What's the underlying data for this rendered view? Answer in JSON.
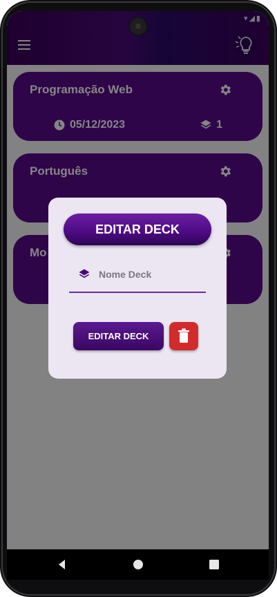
{
  "decks": [
    {
      "title": "Programação Web",
      "date": "05/12/2023",
      "count": "1"
    },
    {
      "title": "Português"
    },
    {
      "title": "Mo"
    }
  ],
  "dialog": {
    "title": "EDITAR DECK",
    "name_placeholder": "Nome Deck",
    "name_value": "",
    "edit_label": "EDITAR DECK"
  },
  "fab": {
    "label": "+"
  },
  "colors": {
    "accent": "#5a0a8c",
    "app_bar": "#3f0060",
    "danger": "#d12b2b",
    "dialog_bg": "#ece6f2"
  },
  "icons": [
    "menu-icon",
    "lightbulb-logo-icon",
    "gear-icon",
    "clock-icon",
    "layers-icon",
    "trash-icon",
    "back-icon",
    "home-icon",
    "recents-icon"
  ]
}
